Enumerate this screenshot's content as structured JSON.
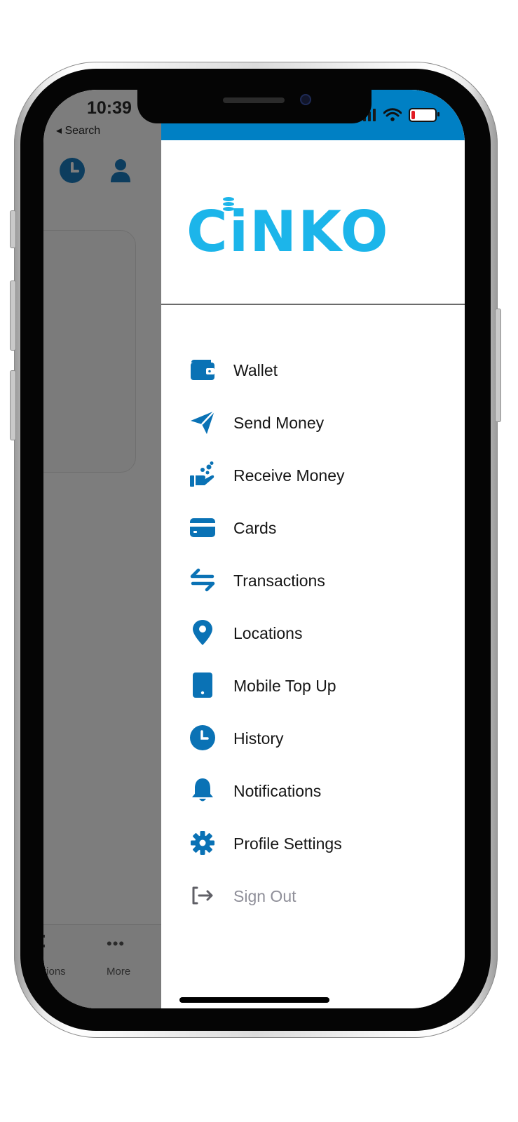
{
  "status_bar": {
    "time": "10:39",
    "back_label": "◂ Search"
  },
  "background_app": {
    "tabbar": {
      "partial_tab_label": "tions",
      "more_label": "More"
    }
  },
  "drawer": {
    "logo_text": "CiNKO",
    "menu": [
      {
        "label": "Wallet",
        "icon": "wallet-icon"
      },
      {
        "label": "Send Money",
        "icon": "paper-plane-icon"
      },
      {
        "label": "Receive Money",
        "icon": "hand-coins-icon"
      },
      {
        "label": "Cards",
        "icon": "credit-card-icon"
      },
      {
        "label": "Transactions",
        "icon": "arrows-swap-icon"
      },
      {
        "label": "Locations",
        "icon": "map-pin-icon"
      },
      {
        "label": "Mobile Top Up",
        "icon": "mobile-phone-icon"
      },
      {
        "label": "History",
        "icon": "clock-icon"
      },
      {
        "label": "Notifications",
        "icon": "bell-icon"
      },
      {
        "label": "Profile Settings",
        "icon": "gear-icon"
      },
      {
        "label": "Sign Out",
        "icon": "sign-out-icon"
      }
    ]
  },
  "colors": {
    "accent": "#0a72b5",
    "header_bar": "#0080c4",
    "logo": "#1cb5ea",
    "signout_text": "#8f8f99",
    "dim_overlay": "#7d7d7d",
    "battery_low": "#e11b22"
  }
}
